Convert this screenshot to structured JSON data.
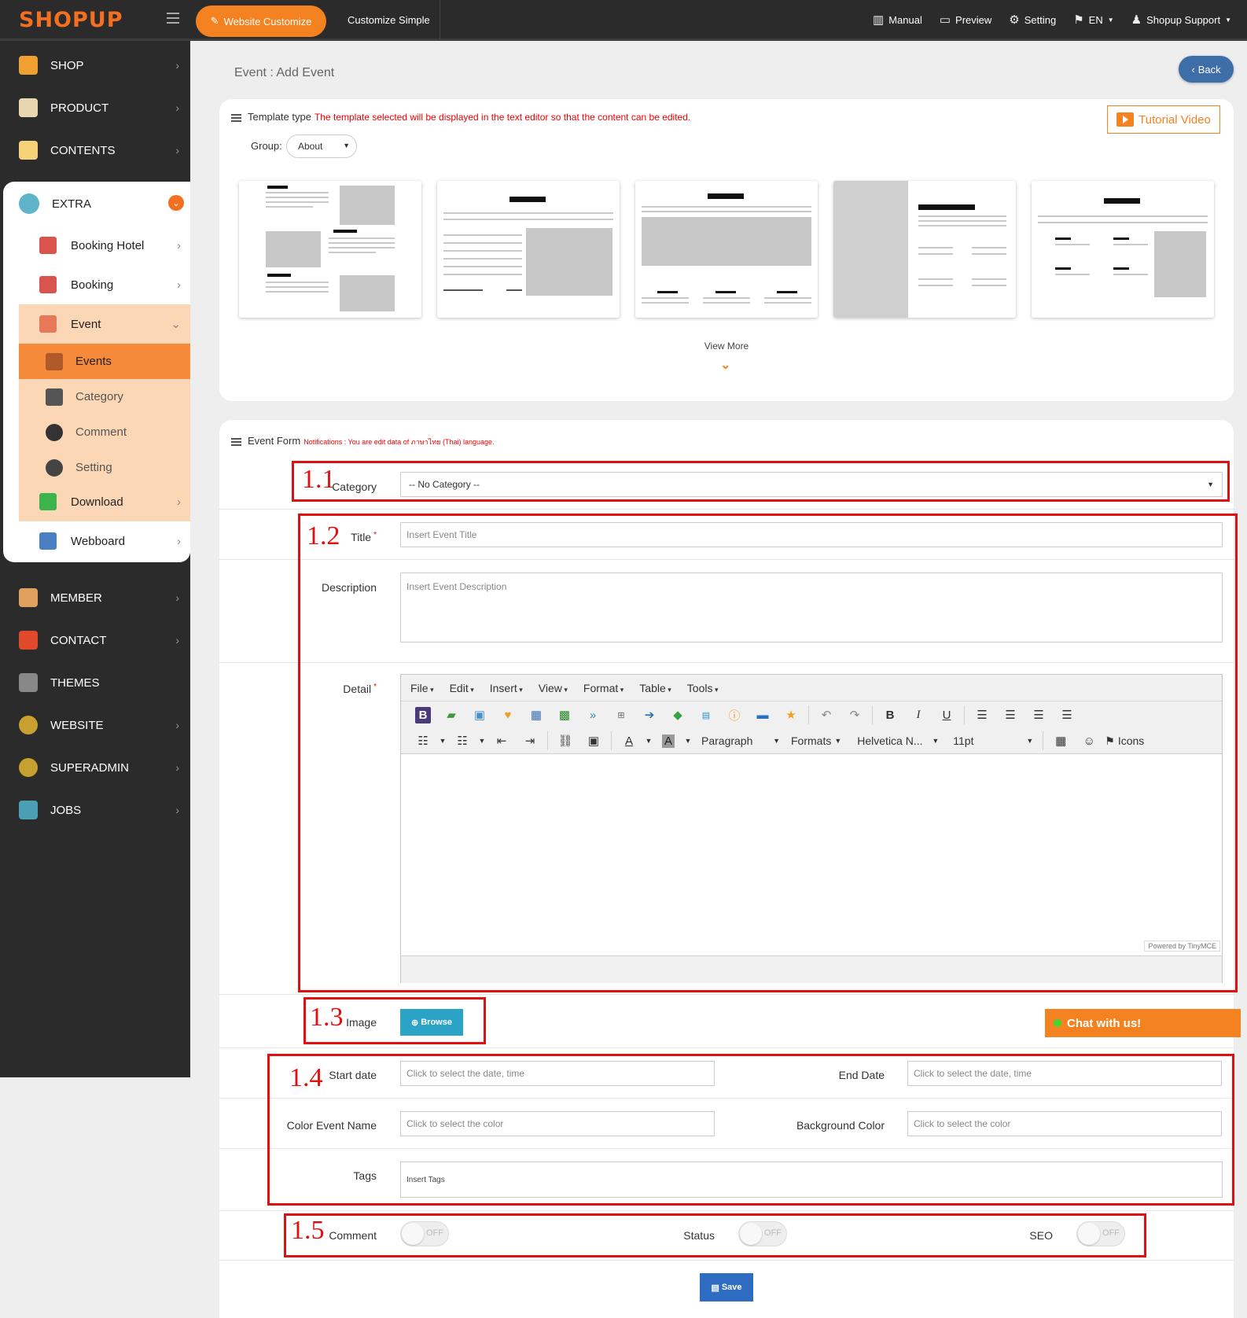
{
  "brand": {
    "logo": "SHOPUP"
  },
  "topbar": {
    "website_customize": "Website Customize",
    "customize_simple": "Customize Simple",
    "manual": "Manual",
    "preview": "Preview",
    "setting": "Setting",
    "language": "EN",
    "support": "Shopup Support"
  },
  "sidebar": {
    "items": [
      {
        "label": "SHOP",
        "icon": "shop-icon"
      },
      {
        "label": "PRODUCT",
        "icon": "product-icon"
      },
      {
        "label": "CONTENTS",
        "icon": "contents-icon"
      },
      {
        "label": "EXTRA",
        "icon": "puzzle-icon"
      },
      {
        "label": "MEMBER",
        "icon": "member-icon"
      },
      {
        "label": "CONTACT",
        "icon": "contact-icon"
      },
      {
        "label": "THEMES",
        "icon": "themes-icon"
      },
      {
        "label": "WEBSITE",
        "icon": "gears-icon"
      },
      {
        "label": "SUPERADMIN",
        "icon": "gears-icon"
      },
      {
        "label": "JOBS",
        "icon": "jobs-icon"
      }
    ],
    "extra_sub": [
      {
        "label": "Booking Hotel"
      },
      {
        "label": "Booking"
      },
      {
        "label": "Event"
      },
      {
        "label": "Download"
      },
      {
        "label": "Webboard"
      }
    ],
    "event_sub": [
      {
        "label": "Events"
      },
      {
        "label": "Category"
      },
      {
        "label": "Comment"
      },
      {
        "label": "Setting"
      }
    ]
  },
  "page": {
    "title": "Event : Add Event",
    "back": "Back"
  },
  "template": {
    "heading": "Template type",
    "note": "The template selected will be displayed in the text editor so that the content can be edited.",
    "tutorial": "Tutorial Video",
    "group_label": "Group:",
    "group_value": "About",
    "view_more": "View More"
  },
  "form": {
    "heading": "Event Form",
    "note": "Notifications : You are edit data of ภาษาไทย (Thai) language.",
    "category_label": "Category",
    "category_value": "-- No Category --",
    "title_label": "Title",
    "title_placeholder": "Insert Event Title",
    "description_label": "Description",
    "description_placeholder": "Insert Event Description",
    "detail_label": "Detail",
    "image_label": "Image",
    "browse": "Browse",
    "start_label": "Start date",
    "start_placeholder": "Click to select the date, time",
    "end_label": "End Date",
    "end_placeholder": "Click to select the date, time",
    "color_name_label": "Color Event Name",
    "color_name_placeholder": "Click to select the color",
    "bg_color_label": "Background Color",
    "bg_color_placeholder": "Click to select the color",
    "tags_label": "Tags",
    "tags_placeholder": "Insert Tags",
    "comment_label": "Comment",
    "status_label": "Status",
    "seo_label": "SEO",
    "toggle_off": "OFF",
    "save": "Save"
  },
  "editor": {
    "menus": [
      "File",
      "Edit",
      "Insert",
      "View",
      "Format",
      "Table",
      "Tools"
    ],
    "paragraph": "Paragraph",
    "formats": "Formats",
    "font": "Helvetica N...",
    "size": "11pt",
    "icons": "Icons",
    "powered": "Powered by TinyMCE"
  },
  "annotations": {
    "a1": "1.1",
    "a2": "1.2",
    "a3": "1.3",
    "a4": "1.4",
    "a5": "1.5"
  },
  "chat": {
    "label": "Chat with us!"
  },
  "colors": {
    "accent": "#f58220",
    "sidebar": "#2b2b2b",
    "annotation": "#e01010",
    "save": "#2d6cc0"
  }
}
